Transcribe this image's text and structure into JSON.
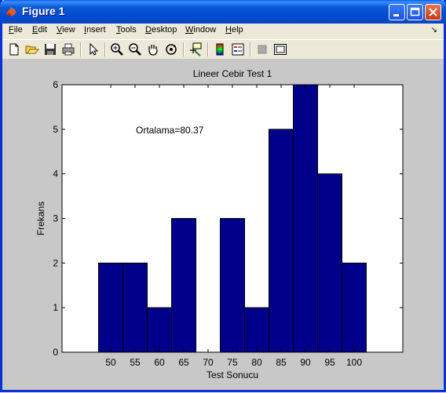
{
  "window": {
    "title": "Figure 1"
  },
  "menu": {
    "items": [
      {
        "key": "F",
        "rest": "ile"
      },
      {
        "key": "E",
        "rest": "dit"
      },
      {
        "key": "V",
        "rest": "iew"
      },
      {
        "key": "I",
        "rest": "nsert"
      },
      {
        "key": "T",
        "rest": "ools"
      },
      {
        "key": "D",
        "rest": "esktop"
      },
      {
        "key": "W",
        "rest": "indow"
      },
      {
        "key": "H",
        "rest": "elp"
      }
    ]
  },
  "toolbar": {
    "icons": [
      "new-figure-icon",
      "open-file-icon",
      "save-icon",
      "print-icon",
      "pointer-icon",
      "zoom-in-icon",
      "zoom-out-icon",
      "pan-hand-icon",
      "rotate-3d-icon",
      "data-cursor-icon",
      "colorbar-icon",
      "legend-icon",
      "hide-plot-tools-icon",
      "show-plot-tools-icon"
    ]
  },
  "chart_data": {
    "type": "bar",
    "title": "Lineer Cebir Test 1",
    "xlabel": "Test Sonucu",
    "ylabel": "Frekans",
    "annotation": "Ortalama=80.37",
    "categories": [
      "50",
      "55",
      "60",
      "65",
      "70",
      "75",
      "80",
      "85",
      "90",
      "95",
      "100"
    ],
    "values": [
      2,
      2,
      1,
      3,
      0,
      3,
      1,
      5,
      6,
      4,
      2
    ],
    "xlim": [
      40,
      110
    ],
    "ylim": [
      0,
      6
    ],
    "yticks": [
      "0",
      "1",
      "2",
      "3",
      "4",
      "5",
      "6"
    ],
    "bar_color": "#00008b",
    "grid": false
  }
}
